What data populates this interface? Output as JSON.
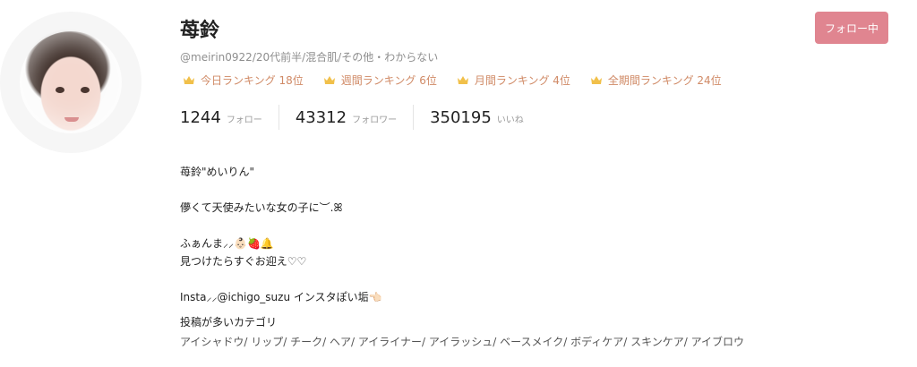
{
  "profile": {
    "name": "苺鈴",
    "meta": "@meirin0922/20代前半/混合肌/その他・わからない",
    "follow_button_label": "フォロー中"
  },
  "rankings": [
    {
      "label": "今日ランキング 18位",
      "icon": "crown-icon"
    },
    {
      "label": "週間ランキング 6位",
      "icon": "crown-icon"
    },
    {
      "label": "月間ランキング 4位",
      "icon": "crown-icon"
    },
    {
      "label": "全期間ランキング 24位",
      "icon": "crown-icon"
    }
  ],
  "stats": [
    {
      "value": "1244",
      "label": "フォロー"
    },
    {
      "value": "43312",
      "label": "フォロワー"
    },
    {
      "value": "350195",
      "label": "いいね"
    }
  ],
  "bio": {
    "line1": "苺鈴\"めいりん\"",
    "line2": "儚くて天使みたいな女の子に︶.ꕤ",
    "line3": "ふぁんま⸝⸝👶🏻🍓🔔",
    "line4": "見つけたらすぐお迎え♡♡",
    "line5": "Insta⸝⸝@ichigo_suzu インスタぽい垢👈🏻"
  },
  "categories": {
    "title": "投稿が多いカテゴリ",
    "list": "アイシャドウ/ リップ/ チーク/ ヘア/ アイライナー/ アイラッシュ/ ベースメイク/ ボディケア/ スキンケア/ アイブロウ"
  },
  "colors": {
    "accent_button": "#e08590",
    "ranking_text": "#d08a66",
    "crown": "#f1c04a"
  }
}
